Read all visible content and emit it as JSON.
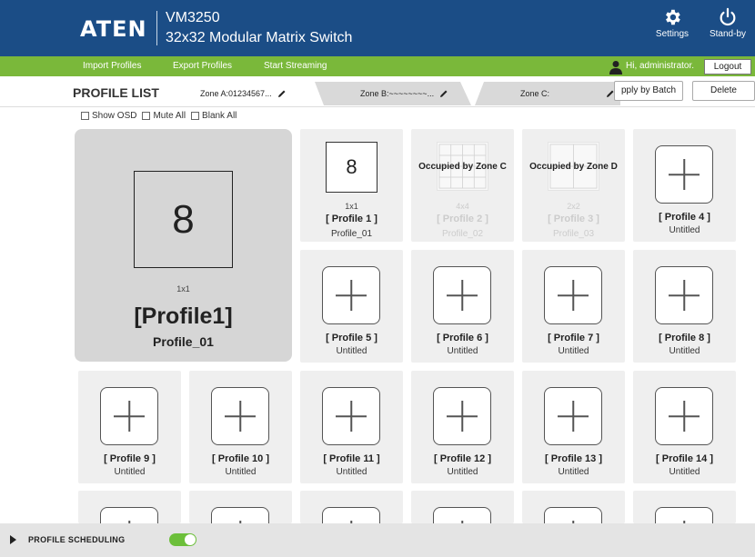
{
  "header": {
    "logo_text": "ATEN",
    "model": "VM3250",
    "subtitle": "32x32 Modular Matrix Switch",
    "settings_label": "Settings",
    "standby_label": "Stand-by",
    "bg_color": "#1b4d86"
  },
  "nav": {
    "items": [
      "Import Profiles",
      "Export Profiles",
      "Start Streaming"
    ],
    "greeting": "Hi, administrator.",
    "logout_label": "Logout",
    "bg_color": "#7ab83a"
  },
  "list": {
    "title": "PROFILE LIST",
    "zones": [
      "Zone A:01234567...",
      "Zone B:~~~~~~~~...",
      "Zone C:"
    ],
    "apply_batch_label": "Apply by Batch",
    "apply_batch_visible": "pply by Batch",
    "delete_label": "Delete"
  },
  "options": [
    "Show OSD",
    "Mute All",
    "Blank All"
  ],
  "preview": {
    "number": "8",
    "type": "1x1",
    "name": "[Profile1]",
    "desc": "Profile_01"
  },
  "profiles": [
    {
      "id": "p1",
      "name": "[ Profile 1 ]",
      "desc": "Profile_01",
      "type": "1x1",
      "number": "8"
    },
    {
      "id": "p2",
      "name": "[ Profile 2 ]",
      "desc": "Profile_02",
      "type": "4x4",
      "occupied": "Occupied by Zone C"
    },
    {
      "id": "p3",
      "name": "[ Profile 3 ]",
      "desc": "Profile_03",
      "type": "2x2",
      "occupied": "Occupied by Zone D"
    },
    {
      "id": "p4",
      "name": "[ Profile 4 ]",
      "desc": "Untitled"
    },
    {
      "id": "p5",
      "name": "[ Profile 5 ]",
      "desc": "Untitled"
    },
    {
      "id": "p6",
      "name": "[ Profile 6 ]",
      "desc": "Untitled"
    },
    {
      "id": "p7",
      "name": "[ Profile 7 ]",
      "desc": "Untitled"
    },
    {
      "id": "p8",
      "name": "[ Profile 8 ]",
      "desc": "Untitled"
    },
    {
      "id": "p9",
      "name": "[ Profile 9 ]",
      "desc": "Untitled"
    },
    {
      "id": "p10",
      "name": "[ Profile 10 ]",
      "desc": "Untitled"
    },
    {
      "id": "p11",
      "name": "[ Profile 11 ]",
      "desc": "Untitled"
    },
    {
      "id": "p12",
      "name": "[ Profile 12 ]",
      "desc": "Untitled"
    },
    {
      "id": "p13",
      "name": "[ Profile 13 ]",
      "desc": "Untitled"
    },
    {
      "id": "p14",
      "name": "[ Profile 14 ]",
      "desc": "Untitled"
    }
  ],
  "footer": {
    "scheduling_label": "PROFILE SCHEDULING",
    "toggle_on": true,
    "toggle_color": "#6cbf3a"
  }
}
